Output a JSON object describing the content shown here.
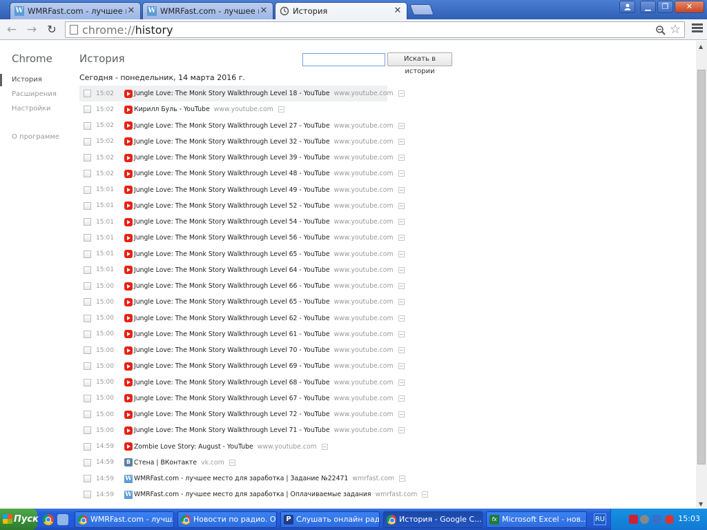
{
  "browser": {
    "tabs": [
      {
        "title": "WMRFast.com - лучшее мес",
        "favicon": "wmrfast-icon",
        "active": false
      },
      {
        "title": "WMRFast.com - лучшее мес",
        "favicon": "wmrfast-icon",
        "active": false
      },
      {
        "title": "История",
        "favicon": "history-icon",
        "active": true
      }
    ],
    "address": {
      "scheme": "chrome://",
      "host": "history"
    }
  },
  "nav": {
    "brand": "Chrome",
    "items": [
      {
        "label": "История",
        "selected": true
      },
      {
        "label": "Расширения",
        "selected": false
      },
      {
        "label": "Настройки",
        "selected": false
      }
    ],
    "about": "О программе"
  },
  "history": {
    "title": "История",
    "search_button": "Искать в истории",
    "search_value": "",
    "day_header": "Сегодня - понедельник, 14 марта 2016 г.",
    "entries": [
      {
        "time": "15:02",
        "title": "Jungle Love: The Monk Story Walkthrough Level 18 - YouTube",
        "domain": "www.youtube.com",
        "icon": "youtube-icon"
      },
      {
        "time": "15:02",
        "title": "Кирилл Буль - YouTube",
        "domain": "www.youtube.com",
        "icon": "youtube-icon"
      },
      {
        "time": "15:02",
        "title": "Jungle Love: The Monk Story Walkthrough Level 27 - YouTube",
        "domain": "www.youtube.com",
        "icon": "youtube-icon"
      },
      {
        "time": "15:02",
        "title": "Jungle Love: The Monk Story Walkthrough Level 32 - YouTube",
        "domain": "www.youtube.com",
        "icon": "youtube-icon"
      },
      {
        "time": "15:02",
        "title": "Jungle Love: The Monk Story Walkthrough Level 39 - YouTube",
        "domain": "www.youtube.com",
        "icon": "youtube-icon"
      },
      {
        "time": "15:02",
        "title": "Jungle Love: The Monk Story Walkthrough Level 48 - YouTube",
        "domain": "www.youtube.com",
        "icon": "youtube-icon"
      },
      {
        "time": "15:01",
        "title": "Jungle Love: The Monk Story Walkthrough Level 49 - YouTube",
        "domain": "www.youtube.com",
        "icon": "youtube-icon"
      },
      {
        "time": "15:01",
        "title": "Jungle Love: The Monk Story Walkthrough Level 52 - YouTube",
        "domain": "www.youtube.com",
        "icon": "youtube-icon"
      },
      {
        "time": "15:01",
        "title": "Jungle Love: The Monk Story Walkthrough Level 54 - YouTube",
        "domain": "www.youtube.com",
        "icon": "youtube-icon"
      },
      {
        "time": "15:01",
        "title": "Jungle Love: The Monk Story Walkthrough Level 56 - YouTube",
        "domain": "www.youtube.com",
        "icon": "youtube-icon"
      },
      {
        "time": "15:01",
        "title": "Jungle Love: The Monk Story Walkthrough Level 65 - YouTube",
        "domain": "www.youtube.com",
        "icon": "youtube-icon"
      },
      {
        "time": "15:01",
        "title": "Jungle Love: The Monk Story Walkthrough Level 64 - YouTube",
        "domain": "www.youtube.com",
        "icon": "youtube-icon"
      },
      {
        "time": "15:00",
        "title": "Jungle Love: The Monk Story Walkthrough Level 66 - YouTube",
        "domain": "www.youtube.com",
        "icon": "youtube-icon"
      },
      {
        "time": "15:00",
        "title": "Jungle Love: The Monk Story Walkthrough Level 65 - YouTube",
        "domain": "www.youtube.com",
        "icon": "youtube-icon"
      },
      {
        "time": "15:00",
        "title": "Jungle Love: The Monk Story Walkthrough Level 62 - YouTube",
        "domain": "www.youtube.com",
        "icon": "youtube-icon"
      },
      {
        "time": "15:00",
        "title": "Jungle Love: The Monk Story Walkthrough Level 61 - YouTube",
        "domain": "www.youtube.com",
        "icon": "youtube-icon"
      },
      {
        "time": "15:00",
        "title": "Jungle Love: The Monk Story Walkthrough Level 70 - YouTube",
        "domain": "www.youtube.com",
        "icon": "youtube-icon"
      },
      {
        "time": "15:00",
        "title": "Jungle Love: The Monk Story Walkthrough Level 69 - YouTube",
        "domain": "www.youtube.com",
        "icon": "youtube-icon"
      },
      {
        "time": "15:00",
        "title": "Jungle Love: The Monk Story Walkthrough Level 68 - YouTube",
        "domain": "www.youtube.com",
        "icon": "youtube-icon"
      },
      {
        "time": "15:00",
        "title": "Jungle Love: The Monk Story Walkthrough Level 67 - YouTube",
        "domain": "www.youtube.com",
        "icon": "youtube-icon"
      },
      {
        "time": "15:00",
        "title": "Jungle Love: The Monk Story Walkthrough Level 72 - YouTube",
        "domain": "www.youtube.com",
        "icon": "youtube-icon"
      },
      {
        "time": "15:00",
        "title": "Jungle Love: The Monk Story Walkthrough Level 71 - YouTube",
        "domain": "www.youtube.com",
        "icon": "youtube-icon"
      },
      {
        "time": "14:59",
        "title": "Zombie Love Story: August - YouTube",
        "domain": "www.youtube.com",
        "icon": "youtube-icon"
      },
      {
        "time": "14:59",
        "title": "Стена | ВКонтакте",
        "domain": "vk.com",
        "icon": "vk-icon"
      },
      {
        "time": "14:59",
        "title": "WMRFast.com - лучшее место для заработка | Задание №22471",
        "domain": "wmrfast.com",
        "icon": "wmrfast-icon"
      },
      {
        "time": "14:59",
        "title": "WMRFast.com - лучшее место для заработка | Оплачиваемые задания",
        "domain": "wmrfast.com",
        "icon": "wmrfast-icon"
      }
    ]
  },
  "taskbar": {
    "start_label": "Пуск",
    "tasks": [
      {
        "label": "WMRFast.com - лучш...",
        "icon": "chrome-icon",
        "active": false
      },
      {
        "label": "Новости по радио. О...",
        "icon": "chrome-icon",
        "active": false
      },
      {
        "label": "Слушать онлайн рад...",
        "icon": "p-app-icon",
        "active": false
      },
      {
        "label": "История - Google C...",
        "icon": "chrome-icon",
        "active": true
      },
      {
        "label": "Microsoft Excel - нов...",
        "icon": "excel-icon",
        "active": false
      }
    ],
    "language": "RU",
    "clock": "15:03"
  }
}
